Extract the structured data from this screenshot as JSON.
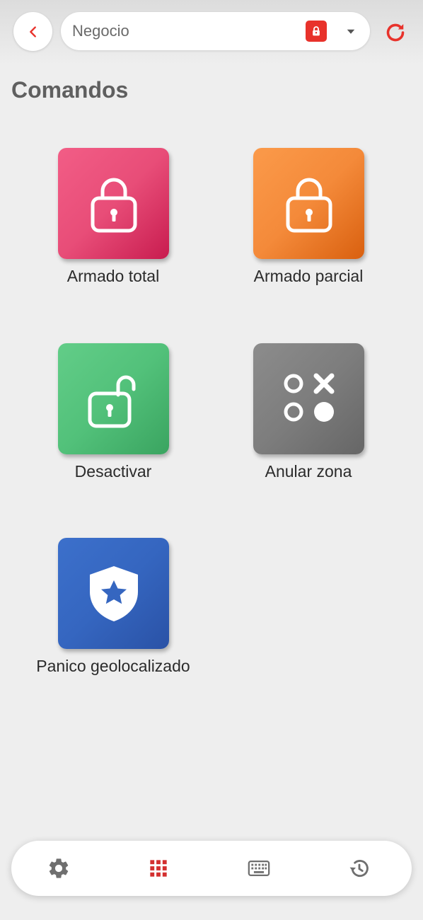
{
  "header": {
    "account_selector": {
      "value": "Negocio",
      "status_icon": "lock-icon",
      "dropdown_icon": "caret-down-icon"
    },
    "back_icon": "chevron-left-icon",
    "refresh_icon": "refresh-icon"
  },
  "page": {
    "title": "Comandos"
  },
  "commands": [
    {
      "label": "Armado total",
      "icon": "lock-closed-icon",
      "color": "#e84d78"
    },
    {
      "label": "Armado parcial",
      "icon": "lock-closed-icon",
      "color": "#f48a3a"
    },
    {
      "label": "Desactivar",
      "icon": "lock-open-icon",
      "color": "#52c17a"
    },
    {
      "label": "Anular zona",
      "icon": "zones-icon",
      "color": "#7d7d7d"
    },
    {
      "label": "Panico geolocalizado",
      "icon": "shield-star-icon",
      "color": "#3566c0"
    }
  ],
  "bottom_nav": [
    {
      "icon": "settings-icon",
      "active": false
    },
    {
      "icon": "grid-icon",
      "active": true
    },
    {
      "icon": "keyboard-icon",
      "active": false
    },
    {
      "icon": "history-icon",
      "active": false
    }
  ],
  "colors": {
    "accent": "#e8322b",
    "background": "#eeeeee"
  }
}
